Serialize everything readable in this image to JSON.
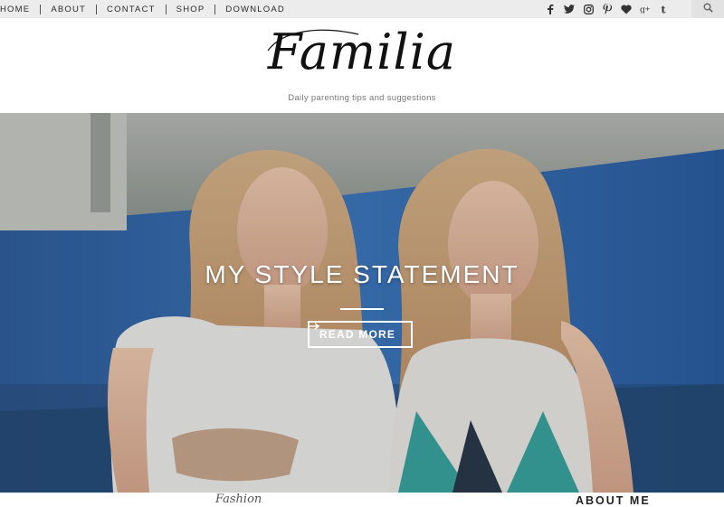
{
  "nav": {
    "items": [
      "HOME",
      "ABOUT",
      "CONTACT",
      "SHOP",
      "DOWNLOAD"
    ]
  },
  "social": {
    "icons": [
      "facebook-icon",
      "twitter-icon",
      "instagram-icon",
      "pinterest-icon",
      "heart-icon",
      "google-plus-icon",
      "tumblr-icon"
    ],
    "search_icon": "search-icon"
  },
  "header": {
    "logo": "Familia",
    "tagline": "Daily parenting tips and suggestions"
  },
  "hero": {
    "title": "MY STYLE STATEMENT",
    "button_label": "READ MORE",
    "button_icon": "arrow-right-icon"
  },
  "bottom": {
    "category_label": "Fashion",
    "sidebar_heading": "ABOUT ME"
  },
  "colors": {
    "topbar": "#ececec",
    "hero_blue": "#3a6fb0",
    "text": "#2a2a2a"
  }
}
